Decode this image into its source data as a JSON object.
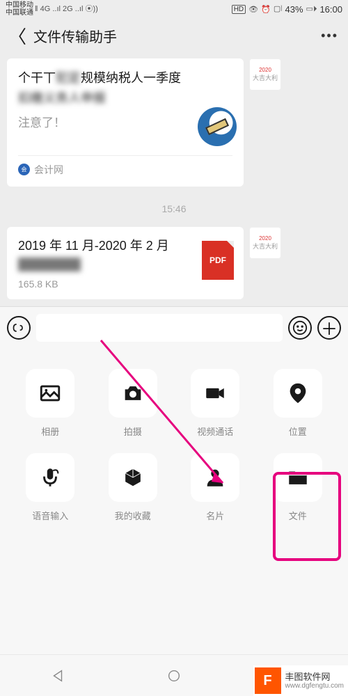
{
  "status": {
    "carrier1": "中国移动",
    "carrier2": "中国联通",
    "net1": "4G",
    "net2": "2G",
    "hd": "HD",
    "battery": "43%",
    "time": "16:00"
  },
  "nav": {
    "title": "文件传输助手"
  },
  "msg1": {
    "line1_a": "个干丅",
    "line1_blur": "犯定",
    "line1_b": "规模纳税人一季度",
    "line2_blur": "扣缴义务人申报",
    "note": "注意了！",
    "source": "会计网"
  },
  "timestamp": "15:46",
  "msg2": {
    "title_a": "2019 年 11 月-2020 年 2 月",
    "title_blur": "的费用明细",
    "size": "165.8 KB",
    "badge": "PDF"
  },
  "panel": {
    "items": [
      {
        "name": "album",
        "label": "相册"
      },
      {
        "name": "camera",
        "label": "拍摄"
      },
      {
        "name": "video-call",
        "label": "视频通话"
      },
      {
        "name": "location",
        "label": "位置"
      },
      {
        "name": "voice-input",
        "label": "语音输入"
      },
      {
        "name": "favorites",
        "label": "我的收藏"
      },
      {
        "name": "contact-card",
        "label": "名片"
      },
      {
        "name": "file",
        "label": "文件"
      }
    ]
  },
  "watermark": {
    "name": "丰图软件网",
    "url": "www.dgfengtu.com",
    "logo": "F"
  }
}
